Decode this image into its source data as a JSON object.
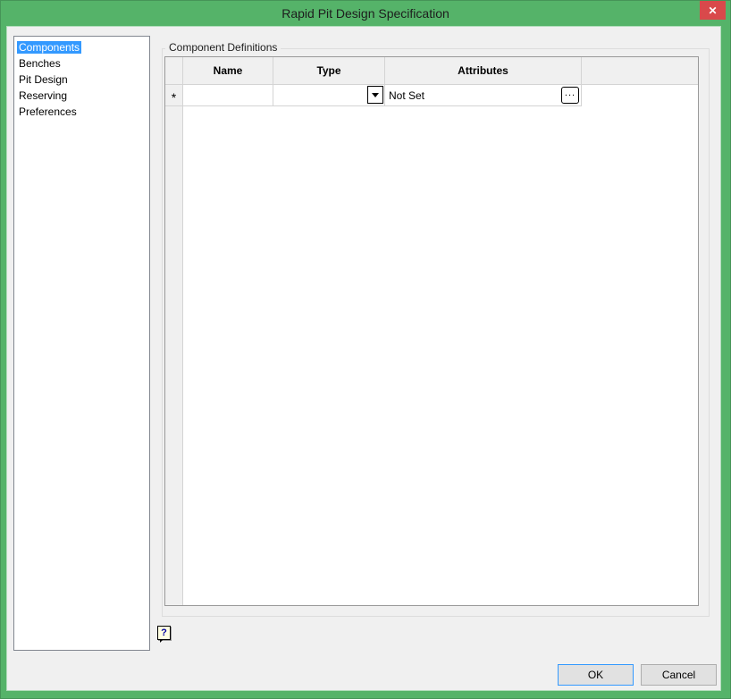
{
  "window": {
    "title": "Rapid Pit Design Specification",
    "close_glyph": "✕"
  },
  "sidebar": {
    "items": [
      {
        "label": "Components",
        "selected": true
      },
      {
        "label": "Benches",
        "selected": false
      },
      {
        "label": "Pit Design",
        "selected": false
      },
      {
        "label": "Reserving",
        "selected": false
      },
      {
        "label": "Preferences",
        "selected": false
      }
    ]
  },
  "main": {
    "group_title": "Component Definitions",
    "table": {
      "columns": [
        "Name",
        "Type",
        "Attributes"
      ],
      "new_row": {
        "marker": "*",
        "name_value": "",
        "type_value": "",
        "attributes_value": "Not Set",
        "browse_label": "..."
      }
    }
  },
  "footer": {
    "help_glyph": "?",
    "ok_label": "OK",
    "cancel_label": "Cancel"
  },
  "colors": {
    "frame_green": "#55b369",
    "close_red": "#d9494b",
    "dialog_bg": "#f0f0f0",
    "selection_blue": "#3399ff",
    "default_button_border": "#3399ff"
  }
}
